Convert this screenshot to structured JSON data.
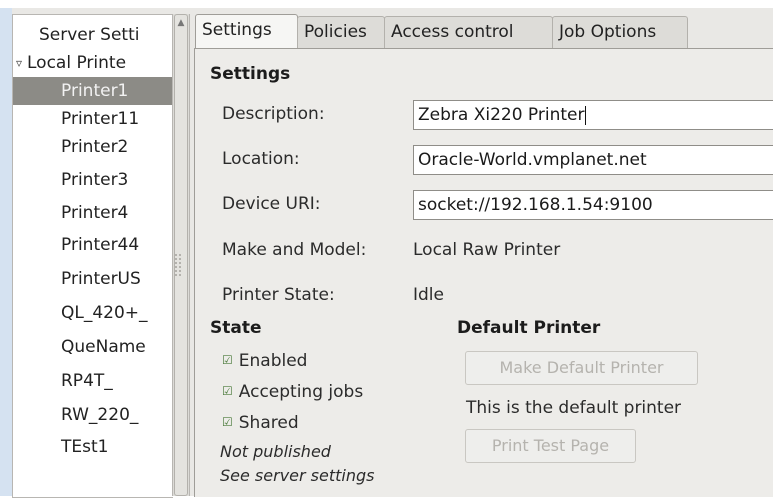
{
  "tree": {
    "items": [
      {
        "label": "Server Setti",
        "indent": 0
      },
      {
        "label": "Local Printe",
        "indent": 0,
        "expanded": true
      },
      {
        "label": "Printer1",
        "selected": true
      },
      {
        "label": "Printer11"
      },
      {
        "label": "Printer2"
      },
      {
        "label": "Printer3"
      },
      {
        "label": "Printer4"
      },
      {
        "label": "Printer44"
      },
      {
        "label": "PrinterUS"
      },
      {
        "label": "QL_420+_"
      },
      {
        "label": "QueName"
      },
      {
        "label": "RP4T_"
      },
      {
        "label": "RW_220_"
      },
      {
        "label": "TEst1"
      }
    ],
    "expander_glyph": "▿"
  },
  "tabs": [
    {
      "label": "Settings",
      "active": true
    },
    {
      "label": "Policies"
    },
    {
      "label": "Access control"
    },
    {
      "label": "Job Options"
    }
  ],
  "settings": {
    "heading": "Settings",
    "description_label": "Description:",
    "description_value": "Zebra Xi220 Printer",
    "location_label": "Location:",
    "location_value": "Oracle-World.vmplanet.net",
    "device_uri_label": "Device URI:",
    "device_uri_value": "socket://192.168.1.54:9100",
    "make_model_label": "Make and Model:",
    "make_model_value": "Local Raw Printer",
    "state_label": "Printer State:",
    "state_value": "Idle"
  },
  "state": {
    "heading": "State",
    "enabled_label": "Enabled",
    "accepting_label": "Accepting jobs",
    "shared_label": "Shared",
    "not_published": "Not published",
    "see_server": "See server settings",
    "check_glyph": "☑"
  },
  "default_printer": {
    "heading": "Default Printer",
    "make_default_button": "Make Default Printer",
    "status_text": "This is the default printer",
    "print_test_button": "Print Test Page"
  },
  "colors": {
    "selection": "#8c8b86",
    "panel": "#edece9",
    "disabled_text": "#b5b3ae"
  }
}
